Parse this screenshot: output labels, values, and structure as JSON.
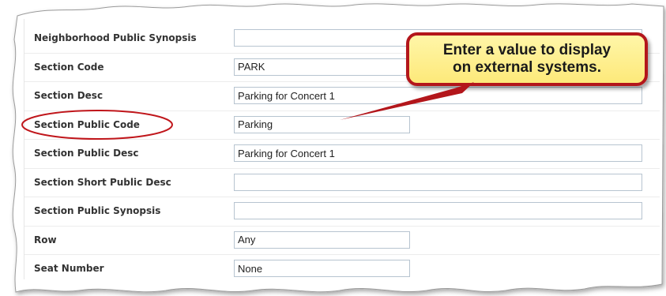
{
  "form": {
    "fields": [
      {
        "label": "Neighborhood Public Synopsis",
        "value": "",
        "size": "wide"
      },
      {
        "label": "Section Code",
        "value": "PARK",
        "size": "wide"
      },
      {
        "label": "Section Desc",
        "value": "Parking for Concert 1",
        "size": "wide"
      },
      {
        "label": "Section Public Code",
        "value": "Parking",
        "size": "short"
      },
      {
        "label": "Section Public Desc",
        "value": "Parking for Concert 1",
        "size": "wide"
      },
      {
        "label": "Section Short Public Desc",
        "value": "",
        "size": "wide"
      },
      {
        "label": "Section Public Synopsis",
        "value": "",
        "size": "wide"
      },
      {
        "label": "Row",
        "value": "Any",
        "size": "short"
      },
      {
        "label": "Seat Number",
        "value": "None",
        "size": "short"
      }
    ]
  },
  "callout": {
    "line1": "Enter a value to display",
    "line2": "on external systems."
  },
  "colors": {
    "highlight_red": "#c0161b",
    "callout_fill": "#fde97a"
  }
}
